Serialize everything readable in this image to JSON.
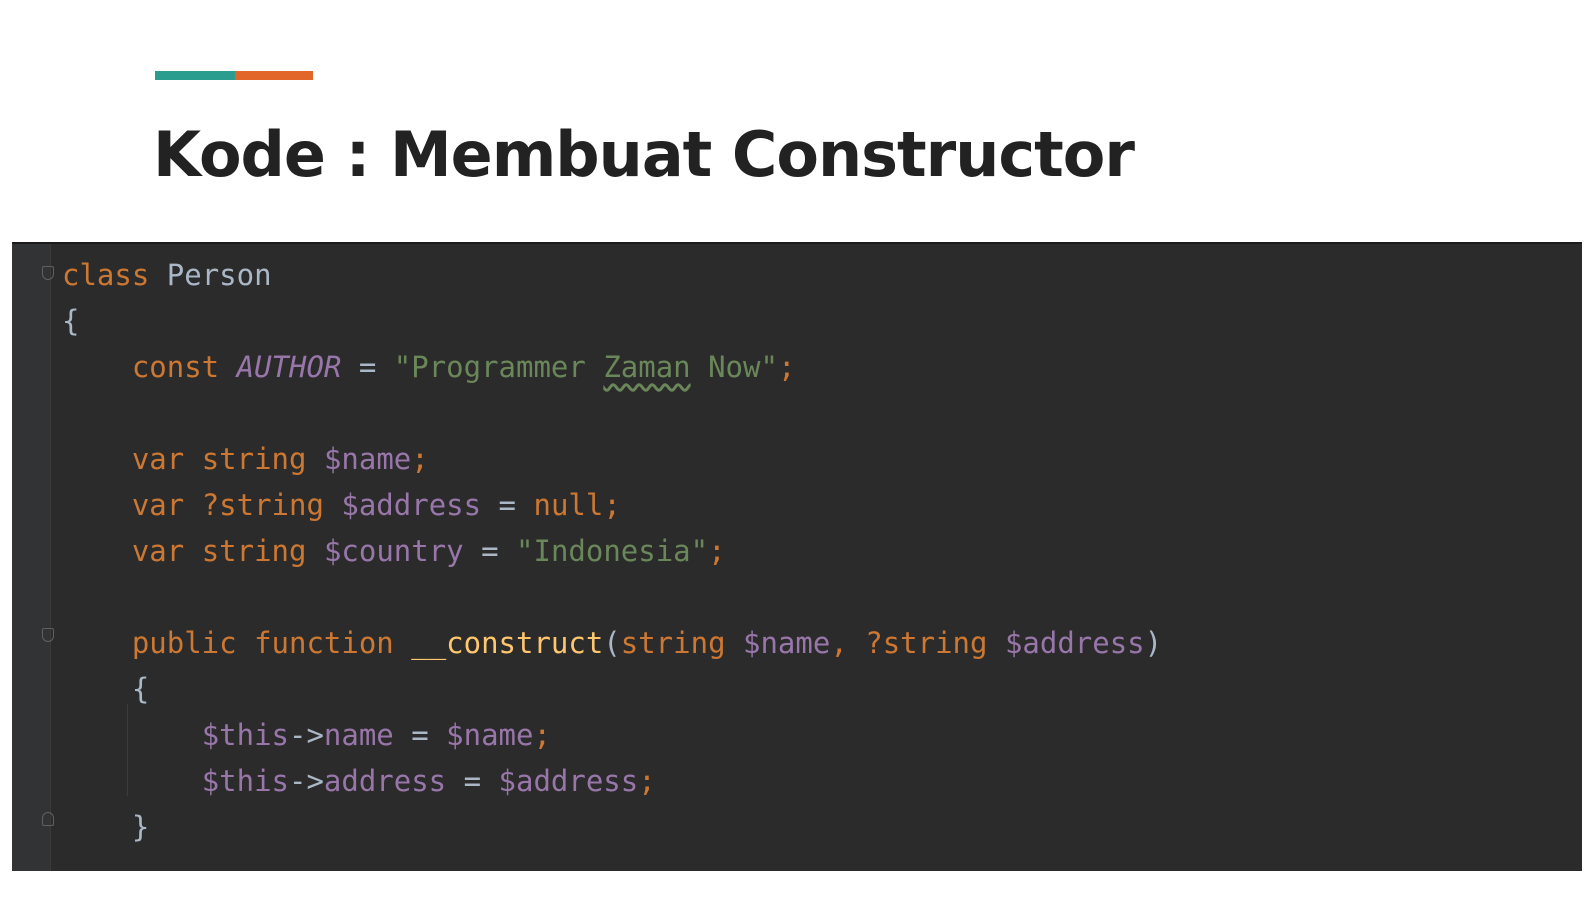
{
  "slide": {
    "title": "Kode : Membuat Constructor",
    "accent_colors": [
      "#2a9d8f",
      "#e2652a"
    ]
  },
  "editor": {
    "theme": "dark",
    "lines": {
      "l1": {
        "kw": "class",
        "name": "Person"
      },
      "l2": {
        "brace": "{"
      },
      "l3": {
        "kw": "const",
        "const_name": "AUTHOR",
        "eq": "=",
        "str_a": "\"Programmer ",
        "str_typo": "Zaman",
        "str_b": " Now\"",
        "semi": ";"
      },
      "l5": {
        "kw": "var",
        "type": "string",
        "var": "$name",
        "semi": ";"
      },
      "l6": {
        "kw": "var",
        "type": "?string",
        "var": "$address",
        "eq": "=",
        "val": "null",
        "semi": ";"
      },
      "l7": {
        "kw": "var",
        "type": "string",
        "var": "$country",
        "eq": "=",
        "str": "\"Indonesia\"",
        "semi": ";"
      },
      "l9": {
        "kw1": "public",
        "kw2": "function",
        "fn": "__construct",
        "open": "(",
        "t1": "string",
        "p1": "$name",
        "comma": ",",
        "t2": "?string",
        "p2": "$address",
        "close": ")"
      },
      "l10": {
        "brace": "{"
      },
      "l11": {
        "this": "$this",
        "arrow": "->",
        "prop": "name",
        "eq": "=",
        "rhs": "$name",
        "semi": ";"
      },
      "l12": {
        "this": "$this",
        "arrow": "->",
        "prop": "address",
        "eq": "=",
        "rhs": "$address",
        "semi": ";"
      },
      "l13": {
        "brace": "}"
      }
    }
  }
}
